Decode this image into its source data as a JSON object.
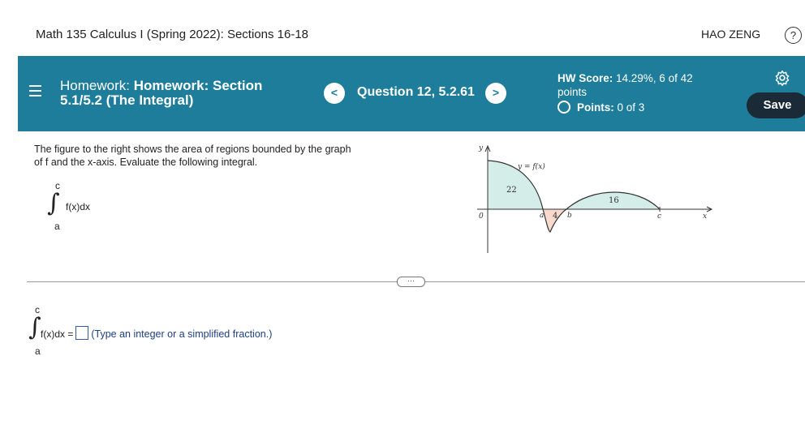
{
  "header": {
    "course_title": "Math 135 Calculus I (Spring 2022): Sections 16-18",
    "user_name": "HAO ZENG",
    "help_symbol": "?"
  },
  "banner": {
    "homework_prefix": "Homework: ",
    "homework_title_line1": "Homework: Section",
    "homework_title_line2": "5.1/5.2 (The Integral)",
    "prev_symbol": "<",
    "next_symbol": ">",
    "question_label": "Question 12, 5.2.61",
    "hw_score_label": "HW Score: ",
    "hw_score_value": "14.29%, 6 of 42",
    "hw_score_line2": "points",
    "points_label": "Points: ",
    "points_value": "0 of 3",
    "save_label": "Save",
    "accent_color": "#1d7d9b",
    "save_bg": "#1a2a36"
  },
  "question": {
    "prompt": "The figure to the right shows the area of regions bounded by the graph of f and the x-axis. Evaluate the following integral.",
    "upper_limit": "c",
    "lower_limit": "a",
    "integrand": "f(x)dx"
  },
  "figure": {
    "y_axis_label": "y",
    "x_axis_label": "x",
    "origin_label": "0",
    "function_label": "y = f(x)",
    "region1_area": "22",
    "region2_area": "4",
    "region3_area": "16",
    "point_a": "a",
    "point_b": "b",
    "point_c": "c"
  },
  "more_button": "···",
  "answer": {
    "upper_limit": "c",
    "lower_limit": "a",
    "lhs": "f(x)dx =",
    "hint": "(Type an integer or a simplified fraction.)"
  }
}
